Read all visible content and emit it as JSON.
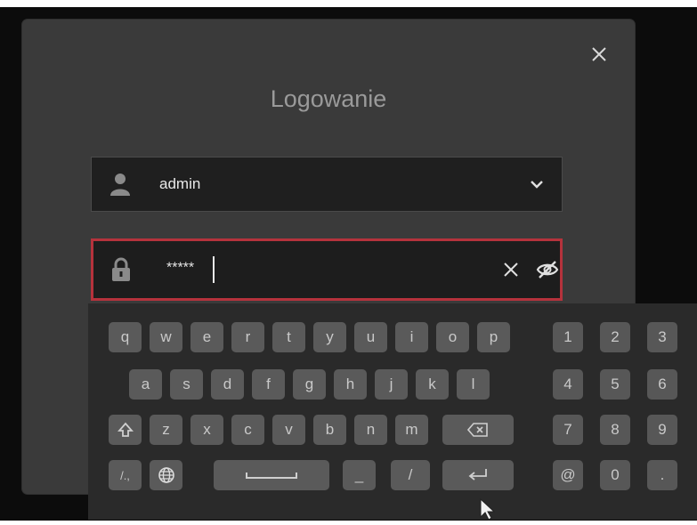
{
  "dialog": {
    "title": "Logowanie",
    "close_icon": "close-icon"
  },
  "username_field": {
    "value": "admin",
    "icon": "user-icon",
    "dropdown_icon": "chevron-down-icon"
  },
  "password_field": {
    "value": "*****",
    "icon": "lock-icon",
    "clear_icon": "clear-icon",
    "visibility_icon": "eye-off-icon",
    "focused_border_color": "#b5323c"
  },
  "keyboard": {
    "row1": [
      "q",
      "w",
      "e",
      "r",
      "t",
      "y",
      "u",
      "i",
      "o",
      "p"
    ],
    "row2": [
      "a",
      "s",
      "d",
      "f",
      "g",
      "h",
      "j",
      "k",
      "l"
    ],
    "row3": [
      "z",
      "x",
      "c",
      "v",
      "b",
      "n",
      "m"
    ],
    "row4_symbols": {
      "mode": "/.,",
      "underscore": "_",
      "slash": "/"
    },
    "numpad": [
      "1",
      "2",
      "3",
      "4",
      "5",
      "6",
      "7",
      "8",
      "9",
      "@",
      "0",
      "."
    ],
    "icons": {
      "shift": "shift-icon",
      "backspace": "backspace-icon",
      "language": "globe-icon",
      "space": "space-icon",
      "enter": "enter-icon"
    }
  }
}
